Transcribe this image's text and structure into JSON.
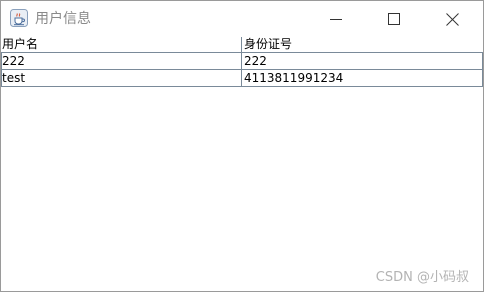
{
  "window": {
    "title": "用户信息",
    "icon": "java-cup-icon"
  },
  "controls": {
    "minimize_icon": "minimize-icon",
    "maximize_icon": "maximize-icon",
    "close_icon": "close-icon"
  },
  "table": {
    "columns": [
      "用户名",
      "身份证号"
    ],
    "rows": [
      [
        "222",
        "222"
      ],
      [
        "test",
        "4113811991234"
      ]
    ]
  },
  "watermark": "CSDN @小码叔"
}
